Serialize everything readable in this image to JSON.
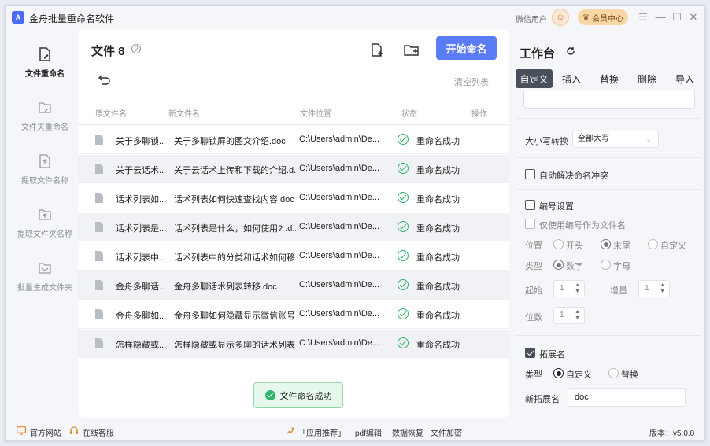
{
  "app": {
    "title": "金舟批量重命名软件",
    "logo_text": "A",
    "user_label": "微信用户",
    "vip_label": "会员中心"
  },
  "window_controls": [
    "☰",
    "—",
    "☐",
    "✕"
  ],
  "sidebar": {
    "items": [
      {
        "label": "文件重命名",
        "icon": "file-edit-icon",
        "active": true
      },
      {
        "label": "文件夹重命名",
        "icon": "folder-edit-icon",
        "active": false
      },
      {
        "label": "提取文件名称",
        "icon": "file-extract-icon",
        "active": false
      },
      {
        "label": "提取文件夹名称",
        "icon": "folder-extract-icon",
        "active": false
      },
      {
        "label": "批量生成文件夹",
        "icon": "folder-generate-icon",
        "active": false
      }
    ]
  },
  "main": {
    "title": "文件 8",
    "help": "?",
    "start_button": "开始命名",
    "clear_list": "清空列表",
    "columns": {
      "original": "原文件名 ↓",
      "new_name": "新文件名",
      "location": "文件位置",
      "status": "状态",
      "action": "操作"
    },
    "rows": [
      {
        "original": "关于多聊锁...",
        "new_name": "关于多聊锁屏的图文介绍.doc",
        "location": "C:\\Users\\admin\\De...",
        "status": "重命名成功"
      },
      {
        "original": "关于云话术...",
        "new_name": "关于云话术上传和下载的介绍.d...",
        "location": "C:\\Users\\admin\\De...",
        "status": "重命名成功"
      },
      {
        "original": "话术列表如...",
        "new_name": "话术列表如何快速查找内容.doc",
        "location": "C:\\Users\\admin\\De...",
        "status": "重命名成功"
      },
      {
        "original": "话术列表是...",
        "new_name": "话术列表是什么，如何使用? .d...",
        "location": "C:\\Users\\admin\\De...",
        "status": "重命名成功"
      },
      {
        "original": "话术列表中...",
        "new_name": "话术列表中的分类和话术如何移...",
        "location": "C:\\Users\\admin\\De...",
        "status": "重命名成功"
      },
      {
        "original": "金舟多聊话...",
        "new_name": "金舟多聊话术列表转移.doc",
        "location": "C:\\Users\\admin\\De...",
        "status": "重命名成功"
      },
      {
        "original": "金舟多聊如...",
        "new_name": "金舟多聊如何隐藏显示微信账号...",
        "location": "C:\\Users\\admin\\De...",
        "status": "重命名成功"
      },
      {
        "original": "怎样隐藏或...",
        "new_name": "怎样隐藏或显示多聊的话术列表...",
        "location": "C:\\Users\\admin\\De...",
        "status": "重命名成功"
      }
    ],
    "toast": "文件命名成功"
  },
  "workspace": {
    "title": "工作台",
    "tabs": [
      "自定义",
      "插入",
      "替换",
      "删除",
      "导入"
    ],
    "active_tab": "自定义",
    "case_label": "大小写转换",
    "case_value": "全部大写",
    "auto_resolve": "自动解决命名冲突",
    "numbering": {
      "title": "编号设置",
      "only_number": "仅使用编号作为文件名",
      "position_label": "位置",
      "position_options": [
        "开头",
        "末尾",
        "自定义"
      ],
      "position_selected": "末尾",
      "type_label": "类型",
      "type_options": [
        "数字",
        "字母"
      ],
      "type_selected": "数字",
      "start_label": "起始",
      "start_value": "1",
      "step_label": "增量",
      "step_value": "1",
      "digits_label": "位数",
      "digits_value": "1"
    },
    "extension": {
      "title": "拓展名",
      "checked": true,
      "type_label": "类型",
      "type_options": [
        "自定义",
        "替换"
      ],
      "type_selected": "自定义",
      "new_label": "新拓展名",
      "new_value": "doc"
    }
  },
  "footer": {
    "website": "官方网站",
    "service": "在线客服",
    "recommend": "「应用推荐」",
    "links": [
      "pdf编辑",
      "数据恢复",
      "文件加密"
    ],
    "version": "版本：v5.0.0"
  },
  "colors": {
    "primary": "#5b7cf7",
    "success": "#2fb56a",
    "tab_active": "#4a4f5c"
  }
}
